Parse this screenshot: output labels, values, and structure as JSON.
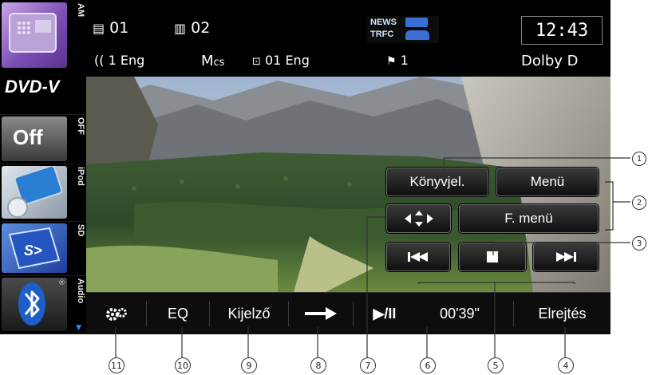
{
  "sidebar": {
    "sources": [
      {
        "label": "AM",
        "icon": "radio-icon"
      },
      {
        "label": "DVD-V"
      },
      {
        "label": "Off",
        "side": "OFF"
      },
      {
        "label": "iPod",
        "icon": "ipod-icon"
      },
      {
        "label": "SD",
        "icon": "sd-card-icon"
      },
      {
        "label": "Audio",
        "icon": "bluetooth-icon"
      }
    ],
    "registered": "®"
  },
  "status": {
    "title_num": "01",
    "chapter_num": "02",
    "audio_lang": "(( 1 Eng",
    "multi_channel": "M",
    "multi_channel_sub": "cs",
    "subtitle": "01 Eng",
    "angle": "1",
    "news_label": "NEWS",
    "trfc_label": "TRFC",
    "clock": "12:43",
    "audio_format": "Dolby D"
  },
  "overlay": {
    "bookmark": "Könyvjel.",
    "menu": "Menü",
    "fmenu": "F. menü"
  },
  "bottom": {
    "eq": "EQ",
    "display": "Kijelző",
    "play_pause": "▶/II",
    "time": "00'39\"",
    "hide": "Elrejtés"
  },
  "callouts": {
    "c1": "1",
    "c2": "2",
    "c3": "3",
    "c4": "4",
    "c5": "5",
    "c6": "6",
    "c7": "7",
    "c8": "8",
    "c9": "9",
    "c10": "10",
    "c11": "11"
  },
  "colors": {
    "bar_bg": "#000000",
    "button_border": "#6a6a6a",
    "text": "#ffffff",
    "bluetooth_blue": "#1d5fc9"
  }
}
